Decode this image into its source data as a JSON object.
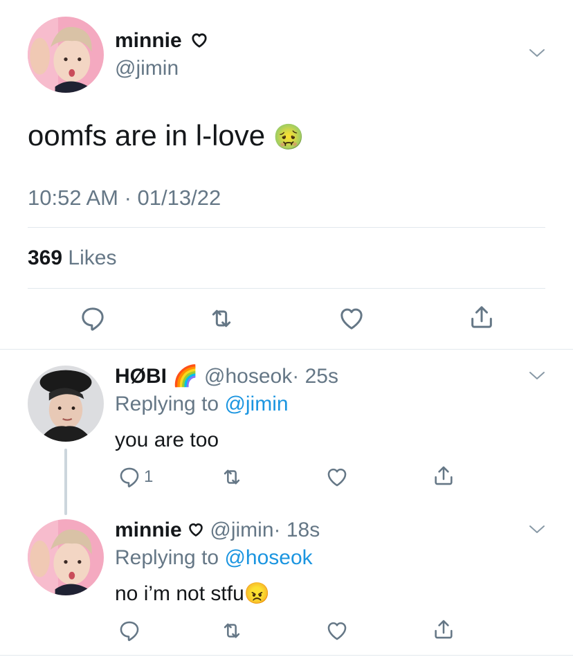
{
  "main_tweet": {
    "display_name": "minnie",
    "handle": "@jimin",
    "text": "oomfs are in l-love",
    "text_emoji": "🤢",
    "timestamp": "10:52 AM · 01/13/22",
    "likes_count": "369",
    "likes_label": "Likes"
  },
  "replies": [
    {
      "display_name": "HØBI",
      "name_emoji": "🌈",
      "handle": "@hoseok",
      "time": "· 25s",
      "replying_prefix": "Replying to",
      "replying_to": "@jimin",
      "text": "you are too",
      "reply_count": "1"
    },
    {
      "display_name": "minnie",
      "handle": "@jimin",
      "time": "· 18s",
      "replying_prefix": "Replying to",
      "replying_to": "@hoseok",
      "text": "no i’m not stfu",
      "text_emoji": "😠"
    }
  ],
  "icons": {
    "heart_name_icon": "heart-outline-icon",
    "chevron": "chevron-down-icon",
    "reply": "reply-icon",
    "retweet": "retweet-icon",
    "like": "like-icon",
    "share": "share-icon"
  },
  "colors": {
    "text_primary": "#14171a",
    "text_secondary": "#657786",
    "link_blue": "#1b95e0",
    "divider": "#e1e8ed",
    "avatar_pink": "#f4a9c0"
  }
}
